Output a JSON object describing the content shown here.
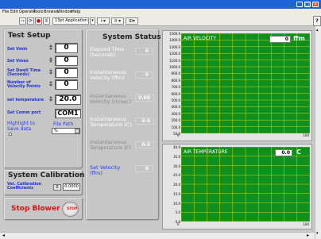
{
  "menu": [
    "File",
    "Edit",
    "Operate",
    "Tools",
    "Browse",
    "Window",
    "Help"
  ],
  "toolbar": {
    "font_select": "13pt Application Font",
    "run_icon": "run-arrow-icon",
    "run_continuous_icon": "run-continuous-icon",
    "abort_icon": "abort-stop-icon",
    "pause_icon": "pause-icon",
    "align_icon": "align-objects-icon",
    "distribute_icon": "distribute-objects-icon",
    "reorder_icon": "reorder-icon",
    "help_icon": "context-help-icon"
  },
  "test_setup": {
    "title": "Test Setup",
    "set_vmin_label": "Set Vmin",
    "set_vmin": "0",
    "set_vmax_label": "Set Vmax",
    "set_vmax": "0",
    "dwell_label": "Set Dwell Time (Seconds)",
    "dwell": "0",
    "points_label": "Number of Velocity Points",
    "points": "0",
    "temperature_label": "set temperature",
    "temperature": "20.0",
    "com_label": "Set Comm port",
    "com_value": "COM1",
    "highlight_label": "Highlight to Save data",
    "file_path_label": "File Path",
    "file_path_value": "%"
  },
  "calibration": {
    "title": "System Calibration",
    "vel_label": "Vel. Calibration Coefficients",
    "vel_index": "0",
    "vel_value": "0.0000"
  },
  "stop": {
    "label": "Stop Blower",
    "button": "STOP"
  },
  "status": {
    "title": "System Status",
    "elapsed_label": "Elapsed Time (Seconds)",
    "elapsed": "0",
    "inst_vel_fpm_label": "Instantaneous Velocity (ffm)",
    "inst_vel_fpm": "0",
    "inst_vel_ms_label": "Instantaneous Velocity (m/sec)",
    "inst_vel_ms": "0.00",
    "inst_temp_c_label": "Instantaneous Temperature (C)",
    "inst_temp_c": "0.0",
    "inst_temp_f_label": "Instantaneous Temperature (F)",
    "inst_temp_f": "0.0",
    "set_vel_label": "Set Velocity (ffm)",
    "set_vel": "0"
  },
  "chart_data": [
    {
      "type": "line",
      "title": "AIR VELOCITY",
      "current_value": "0",
      "unit": "ffm",
      "y_ticks": [
        "1500.0",
        "1400.0",
        "1300.0",
        "1200.0",
        "1100.0",
        "1000.0",
        "900.0",
        "800.0",
        "700.0",
        "600.0",
        "500.0",
        "400.0",
        "300.0",
        "200.0",
        "100.0",
        "50.0"
      ],
      "x_ticks": [
        "0",
        "100"
      ],
      "ylim": [
        50,
        1500
      ],
      "xlim": [
        0,
        100
      ],
      "grid": true,
      "series": []
    },
    {
      "type": "line",
      "title": "AIR TEMPERATURE",
      "current_value": "0.0",
      "unit": "C",
      "y_ticks": [
        "40.0",
        "35.0",
        "30.0",
        "25.0",
        "20.0",
        "15.0",
        "10.0",
        "5.0",
        "0.0"
      ],
      "x_ticks": [
        "0",
        "100"
      ],
      "ylim": [
        0,
        40
      ],
      "xlim": [
        0,
        100
      ],
      "grid": true,
      "series": []
    }
  ],
  "colors": {
    "plot_bg": "#0f8f1e",
    "grid": "#d7d600",
    "label_blue": "#1e30d8",
    "stop_red": "#e01010"
  }
}
